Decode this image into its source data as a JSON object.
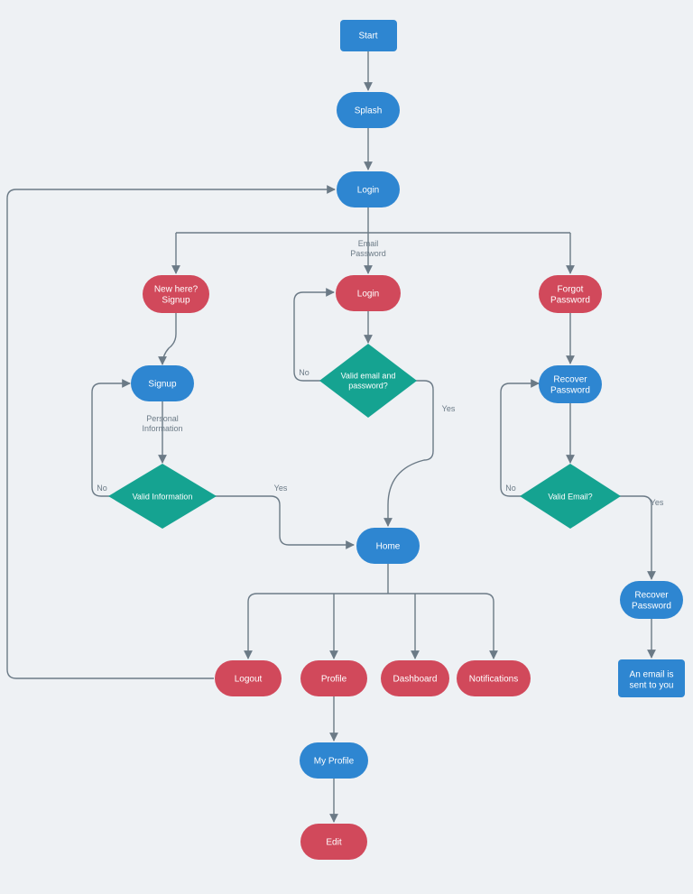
{
  "nodes": {
    "start": {
      "label": "Start"
    },
    "splash": {
      "label": "Splash"
    },
    "login": {
      "label": "Login"
    },
    "newHereSignup": {
      "line1": "New here?",
      "line2": "Signup"
    },
    "login2": {
      "label": "Login"
    },
    "forgotPassword": {
      "line1": "Forgot",
      "line2": "Password"
    },
    "signup": {
      "label": "Signup"
    },
    "validEmailPw": {
      "line1": "Valid email and",
      "line2": "password?"
    },
    "recoverPw": {
      "line1": "Recover",
      "line2": "Password"
    },
    "validInfo": {
      "label": "Valid Information"
    },
    "validEmail": {
      "label": "Valid Email?"
    },
    "home": {
      "label": "Home"
    },
    "recoverPw2": {
      "line1": "Recover",
      "line2": "Password"
    },
    "logout": {
      "label": "Logout"
    },
    "profile": {
      "label": "Profile"
    },
    "dashboard": {
      "label": "Dashboard"
    },
    "notifications": {
      "label": "Notifications"
    },
    "emailSent": {
      "line1": "An email is",
      "line2": "sent to you"
    },
    "myProfile": {
      "label": "My Profile"
    },
    "edit": {
      "label": "Edit"
    }
  },
  "edgeLabels": {
    "emailPassword1": "Email",
    "emailPassword2": "Password",
    "no": "No",
    "yes": "Yes",
    "personalInfo1": "Personal",
    "personalInfo2": "Information"
  }
}
